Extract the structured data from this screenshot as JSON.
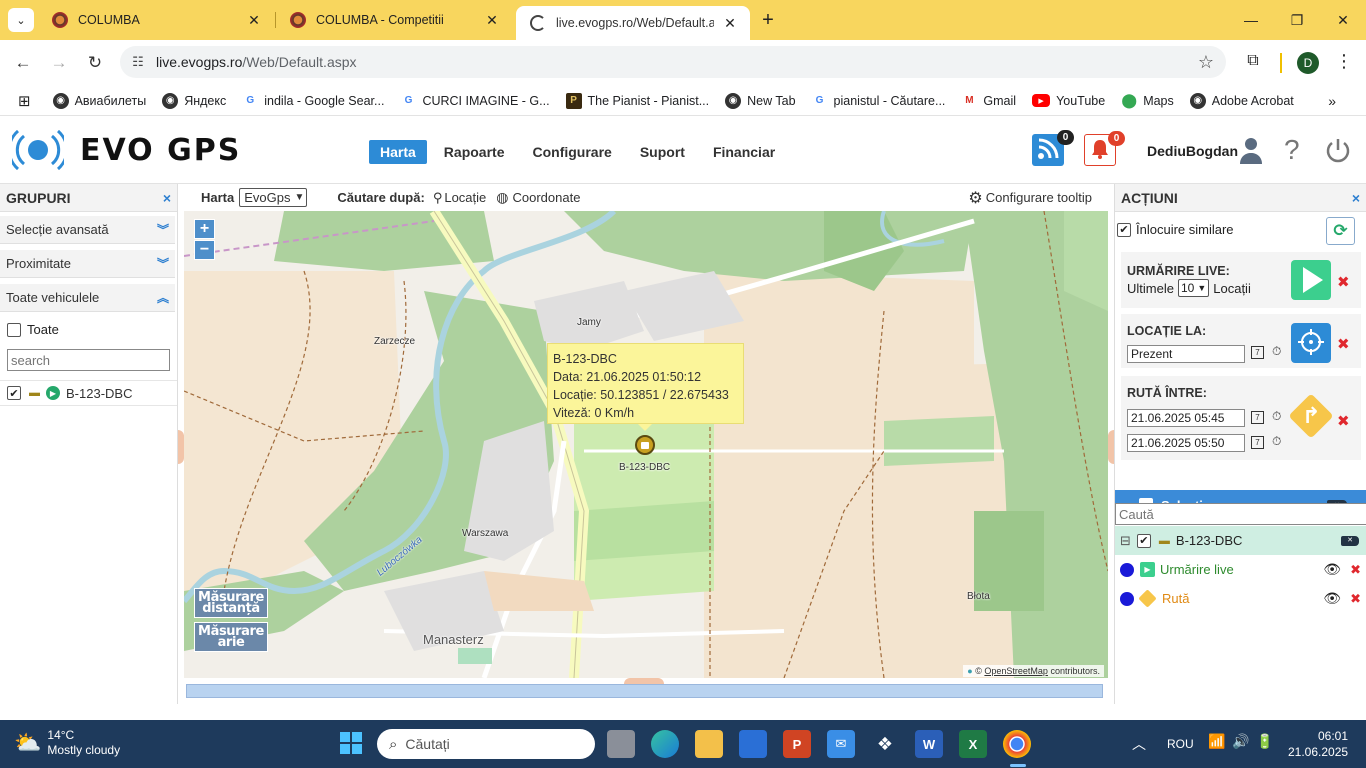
{
  "browser": {
    "tabs": [
      {
        "title": "COLUMBA",
        "active": false
      },
      {
        "title": "COLUMBA - Competitii",
        "active": false
      },
      {
        "title": "live.evogps.ro/Web/Default.aspx",
        "active": true
      }
    ],
    "url_domain": "live.evogps.ro",
    "url_path": "/Web/Default.aspx",
    "profile_initial": "D",
    "bookmarks": [
      "Авиабилеты",
      "Яндекс",
      "indila - Google Sear...",
      "CURCI IMAGINE - G...",
      "The Pianist - Pianist...",
      "New Tab",
      "pianistul - Căutare...",
      "Gmail",
      "YouTube",
      "Maps",
      "Adobe Acrobat"
    ],
    "accent_color": "#f8d65e"
  },
  "app": {
    "logo_text": "EVO GPS",
    "menu": [
      "Harta",
      "Rapoarte",
      "Configurare",
      "Suport",
      "Financiar"
    ],
    "active_menu": "Harta",
    "feed_count": "0",
    "alert_count": "0",
    "username": "DediuBogdan",
    "brand_color": "#2d8bd6"
  },
  "left_panel": {
    "title": "GRUPURI",
    "close": "×",
    "sections": [
      "Selecție avansată",
      "Proximitate",
      "Toate vehiculele"
    ],
    "all_label": "Toate",
    "search_placeholder": "search",
    "vehicle": "B-123-DBC"
  },
  "map": {
    "harta_label": "Harta",
    "harta_value": "EvoGps",
    "search_by_label": "Căutare după:",
    "search_location": "Locație",
    "search_coords": "Coordonate",
    "tooltip_config": "Configurare tooltip",
    "zoom_in": "+",
    "zoom_out": "−",
    "measure_distance_1": "Măsurare",
    "measure_distance_2": "distanță",
    "measure_area_1": "Măsurare",
    "measure_area_2": "arie",
    "tooltip": {
      "title": "B-123-DBC",
      "date": "Data: 21.06.2025 01:50:12",
      "location": "Locație: 50.123851 / 22.675433",
      "speed": "Viteză: 0 Km/h"
    },
    "marker_label": "B-123-DBC",
    "place_labels": [
      "Jamy",
      "Zarzecze",
      "Warszawa",
      "Manasterz",
      "Błota",
      "Luboczówka"
    ],
    "attribution_prefix": "©",
    "attribution_link": "OpenStreetMap",
    "attribution_suffix": "contributors."
  },
  "right_panel": {
    "title": "ACȚIUNI",
    "close": "×",
    "replace_similar": "Înlocuire similare",
    "live": {
      "title": "URMĂRIRE LIVE:",
      "last": "Ultimele",
      "count": "10",
      "unit": "Locații"
    },
    "location_at": {
      "title": "LOCAȚIE LA:",
      "value": "Prezent"
    },
    "route": {
      "title": "RUTĂ ÎNTRE:",
      "start": "21.06.2025 05:45",
      "end": "21.06.2025 05:50"
    },
    "calendar_day": "7",
    "selection_title": "Selecție",
    "selection_search": "Caută",
    "tree": {
      "vehicle": "B-123-DBC",
      "collapse": "⊟",
      "items": [
        {
          "label": "Urmărire live",
          "color": "#2e8b2e"
        },
        {
          "label": "Rută",
          "color": "#e08a14"
        }
      ]
    }
  },
  "taskbar": {
    "weather_temp": "14°C",
    "weather_desc": "Mostly cloudy",
    "search_placeholder": "Căutați",
    "lang": "ROU",
    "time": "06:01",
    "date": "21.06.2025"
  }
}
